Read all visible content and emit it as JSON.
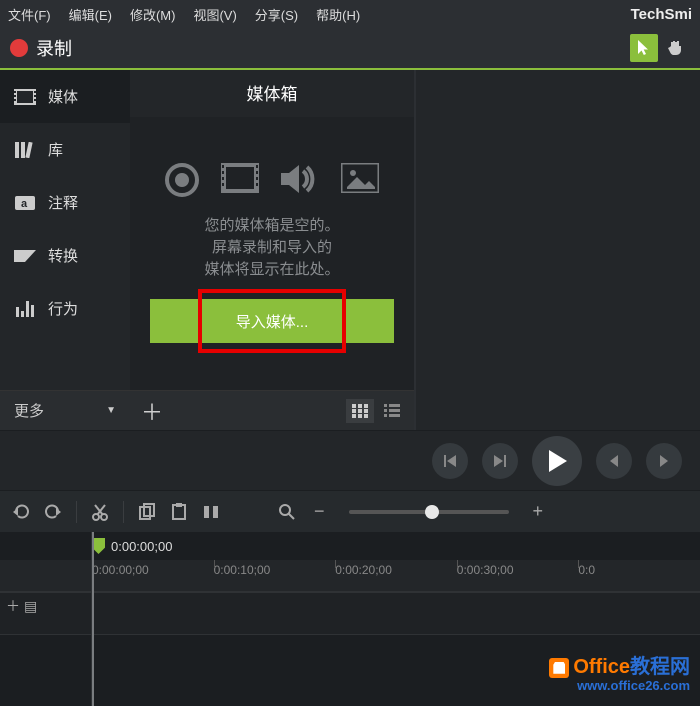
{
  "menu": {
    "items": [
      "文件(F)",
      "编辑(E)",
      "修改(M)",
      "视图(V)",
      "分享(S)",
      "帮助(H)"
    ],
    "brand": "TechSmi"
  },
  "toolbar": {
    "record": "录制"
  },
  "sidebar": {
    "items": [
      {
        "label": "媒体"
      },
      {
        "label": "库"
      },
      {
        "label": "注释"
      },
      {
        "label": "转换"
      },
      {
        "label": "行为"
      }
    ],
    "more": "更多"
  },
  "mediabin": {
    "title": "媒体箱",
    "empty1": "您的媒体箱是空的。",
    "empty2": "屏幕录制和导入的",
    "empty3": "媒体将显示在此处。",
    "import": "导入媒体..."
  },
  "timeline": {
    "current": "0:00:00;00",
    "ticks": [
      "0:00:00;00",
      "0:00:10;00",
      "0:00:20;00",
      "0:00:30;00",
      "0:0"
    ]
  },
  "watermark": {
    "line1a": "Office",
    "line1b": "教程网",
    "line2": "www.office26.com"
  }
}
